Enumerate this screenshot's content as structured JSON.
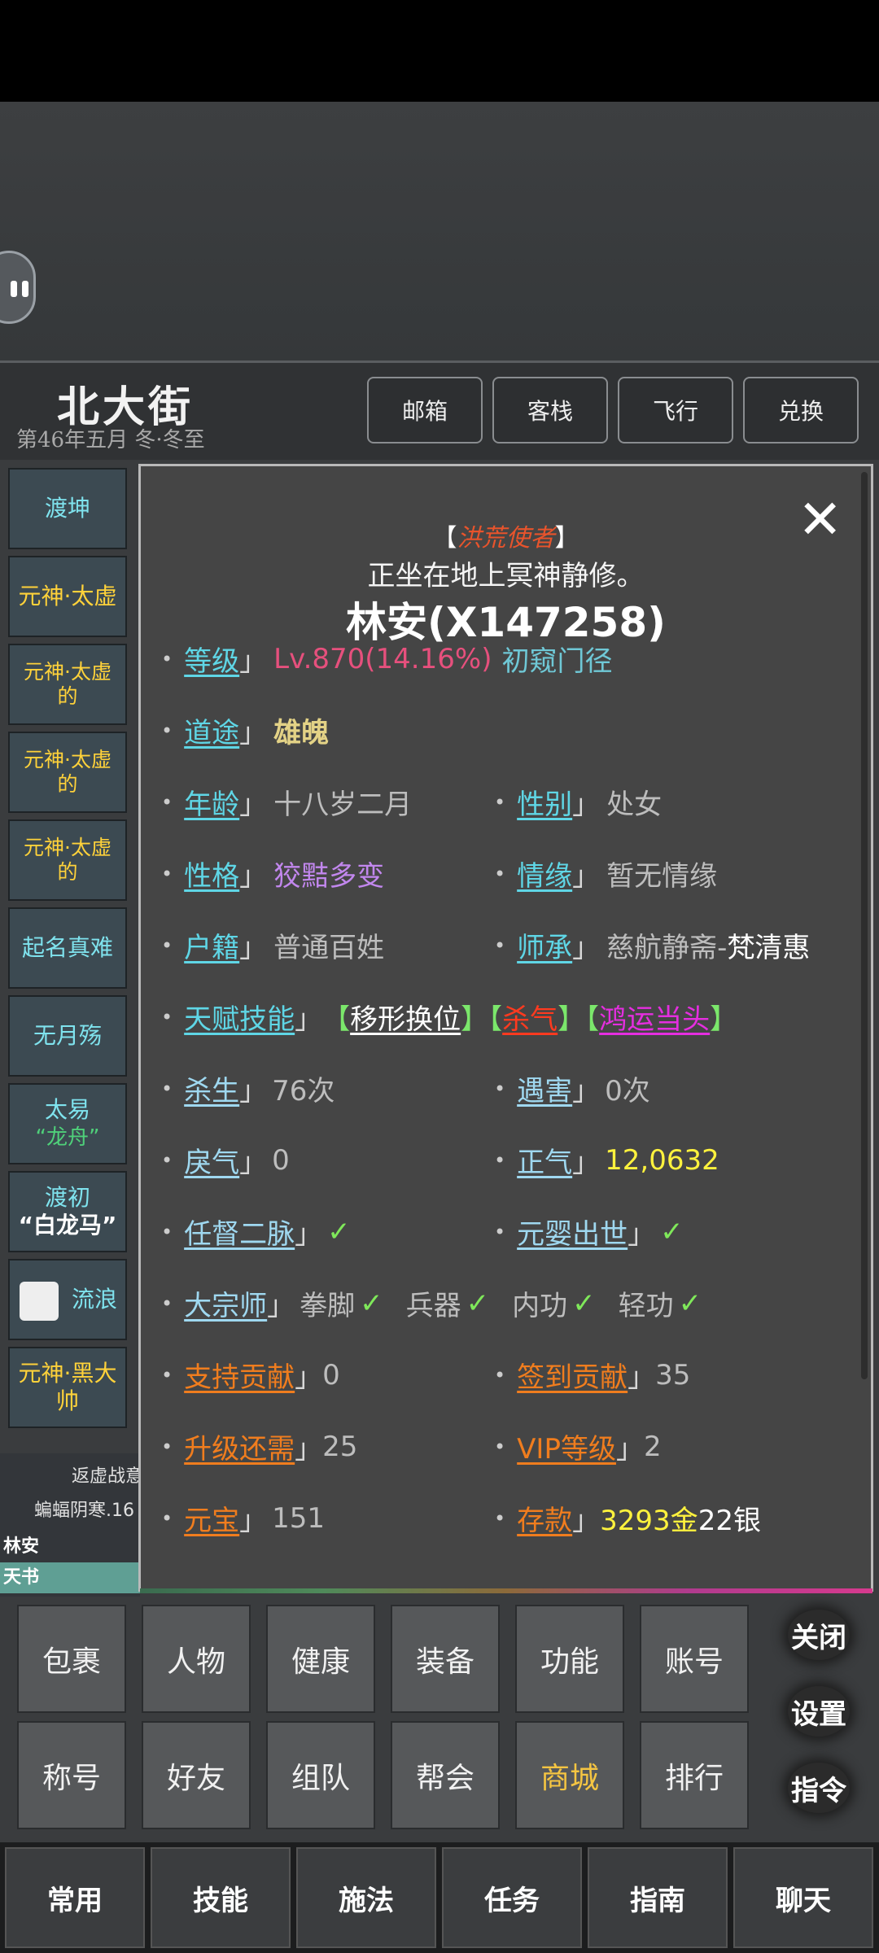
{
  "location": {
    "name": "北大街",
    "date": "第46年五月  冬·冬至"
  },
  "top_buttons": [
    "邮箱",
    "客栈",
    "飞行",
    "兑换"
  ],
  "sidebar": [
    {
      "lines": [
        "渡坤"
      ],
      "style": [
        "c1"
      ]
    },
    {
      "lines": [
        "元神·太虚"
      ],
      "style": [
        "y"
      ]
    },
    {
      "lines": [
        "元神·太虚",
        "的"
      ],
      "style": [
        "y sm",
        "y sm"
      ]
    },
    {
      "lines": [
        "元神·太虚",
        "的"
      ],
      "style": [
        "y sm",
        "y sm"
      ]
    },
    {
      "lines": [
        "元神·太虚",
        "的"
      ],
      "style": [
        "y sm",
        "y sm"
      ]
    },
    {
      "lines": [
        "起名真难"
      ],
      "style": [
        "c1"
      ]
    },
    {
      "lines": [
        "无月殇"
      ],
      "style": [
        "c1"
      ]
    },
    {
      "lines": [
        "太易",
        "“龙舟”"
      ],
      "style": [
        "c1",
        "g"
      ]
    },
    {
      "lines": [
        "渡初",
        "“白龙马”"
      ],
      "style": [
        "c1",
        "w"
      ]
    },
    {
      "lines": [
        "流浪"
      ],
      "style": [
        "c1"
      ]
    },
    {
      "lines": [
        "元神·黑大",
        "帅"
      ],
      "style": [
        "y",
        "y"
      ]
    }
  ],
  "chat": {
    "line1": "返虚战意",
    "line2": "蝙蝠阴寒.16",
    "name": "林安",
    "tab": "天书"
  },
  "profile": {
    "title": "洪荒使者",
    "action": "正坐在地上冥神静修。",
    "name": "林安(X147258)",
    "level": {
      "label": "等级",
      "value": "Lv.870(14.16%)",
      "rank": "初窥门径"
    },
    "path": {
      "label": "道途",
      "value": "雄魄"
    },
    "age": {
      "label": "年龄",
      "value": "十八岁二月"
    },
    "gender": {
      "label": "性别",
      "value": "处女"
    },
    "character": {
      "label": "性格",
      "value": "狡黠多变"
    },
    "romance": {
      "label": "情缘",
      "value": "暂无情缘"
    },
    "household": {
      "label": "户籍",
      "value": "普通百姓"
    },
    "master": {
      "label": "师承",
      "value_sect": "慈航静斋-",
      "value_name": "梵清惠"
    },
    "talent": {
      "label": "天赋技能",
      "skill1": "移形换位",
      "skill2": "杀气",
      "skill3": "鸿运当头"
    },
    "kills": {
      "label": "杀生",
      "value": "76次"
    },
    "harmed": {
      "label": "遇害",
      "value": "0次"
    },
    "hostility": {
      "label": "戾气",
      "value": "0"
    },
    "righteous": {
      "label": "正气",
      "value": "12,0632"
    },
    "meridian": {
      "label": "任督二脉",
      "check": "✓"
    },
    "nascent": {
      "label": "元婴出世",
      "check": "✓"
    },
    "grandmaster": {
      "label": "大宗师",
      "items": [
        "拳脚",
        "兵器",
        "内功",
        "轻功"
      ],
      "check": "✓"
    },
    "support": {
      "label": "支持贡献",
      "value": "0"
    },
    "signin": {
      "label": "签到贡献",
      "value": "35"
    },
    "upgrade": {
      "label": "升级还需",
      "value": "25"
    },
    "vip": {
      "label": "VIP等级",
      "value": "2"
    },
    "ingot": {
      "label": "元宝",
      "value": "151"
    },
    "deposit": {
      "label": "存款",
      "gold": "3293金",
      "silver": "22银"
    }
  },
  "menu_row1": [
    "包裹",
    "人物",
    "健康",
    "装备",
    "功能",
    "账号"
  ],
  "menu_row2": [
    "称号",
    "好友",
    "组队",
    "帮会",
    "商城",
    "排行"
  ],
  "right_buttons": [
    "关闭",
    "设置",
    "指令"
  ],
  "bottom_tabs": [
    "常用",
    "技能",
    "施法",
    "任务",
    "指南",
    "聊天"
  ],
  "colors": {
    "highlight_shop": "#f5c542",
    "panel_bg": "#454545"
  }
}
